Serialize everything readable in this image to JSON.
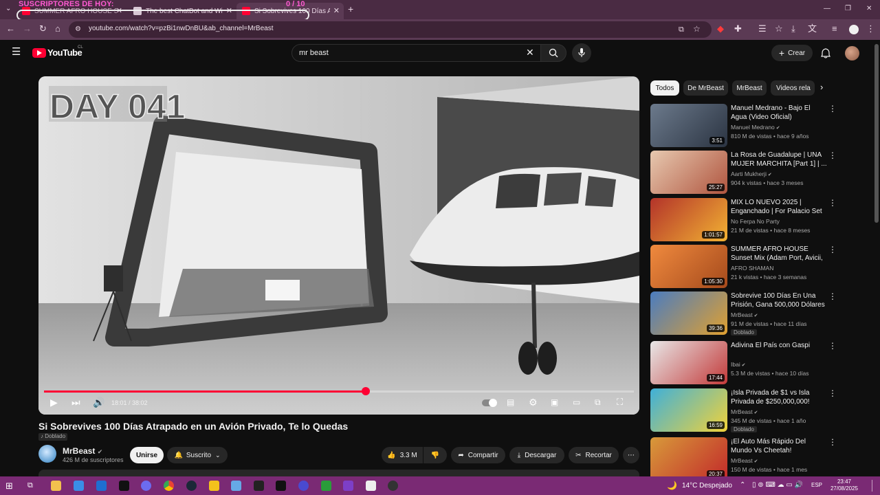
{
  "overlay": {
    "title": "SUSCRIPTORES DE HOY:",
    "count": "0 / 10"
  },
  "tabs": [
    {
      "title": "SUMMER AFRO HOUSE Sunset"
    },
    {
      "title": "The best ChatBot and Widgets"
    },
    {
      "title": "Si Sobrevives 100 Días Atrapado"
    }
  ],
  "browser": {
    "url": "youtube.com/watch?v=pzBi1nwDnBU&ab_channel=MrBeast"
  },
  "header": {
    "logo": "YouTube",
    "region": "CL",
    "search_value": "mr beast",
    "create_label": "Crear"
  },
  "player": {
    "overlay_text": "DAY 041",
    "time": "18:01 / 38:02",
    "progress": 0.545
  },
  "video": {
    "title": "Si Sobrevives 100 Días Atrapado en un Avión Privado, Te lo Quedas",
    "dub_badge": "Doblado",
    "channel": "MrBeast",
    "subscribers": "426 M de suscriptores",
    "join_label": "Unirse",
    "subscribed_label": "Suscrito",
    "likes": "3.3 M",
    "share_label": "Compartir",
    "download_label": "Descargar",
    "clip_label": "Recortar"
  },
  "chips": [
    "Todos",
    "De MrBeast",
    "MrBeast",
    "Videos rela"
  ],
  "recommendations": [
    {
      "title": "Manuel Medrano - Bajo El Agua (Video Oficial)",
      "channel": "Manuel Medrano",
      "verified": true,
      "meta": "810 M de vistas • hace 9 años",
      "duration": "3:51",
      "dubbed": "",
      "colors": [
        "#6c7a8c",
        "#2b3442"
      ]
    },
    {
      "title": "La Rosa de Guadalupe | UNA MUJER MARCHITA [Part 1] | ...",
      "channel": "Aarti Mukherji",
      "verified": true,
      "meta": "904 k vistas • hace 3 meses",
      "duration": "25:27",
      "dubbed": "",
      "colors": [
        "#e7c9b0",
        "#b0553f"
      ]
    },
    {
      "title": "MIX LO NUEVO 2025 | Enganchado | For Palacio Set ...",
      "channel": "No Ferpa No Party",
      "verified": false,
      "meta": "21 M de vistas • hace 8 meses",
      "duration": "1:01:57",
      "dubbed": "",
      "colors": [
        "#b3332a",
        "#f2b233"
      ]
    },
    {
      "title": "SUMMER AFRO HOUSE Sunset Mix (Adam Port, Avicii, The ...",
      "channel": "AFRO SHAMAN",
      "verified": false,
      "meta": "21 k vistas • hace 3 semanas",
      "duration": "1:05:30",
      "dubbed": "",
      "colors": [
        "#f08a3e",
        "#a54a1c"
      ]
    },
    {
      "title": "Sobrevive 100 Días En Una Prisión, Gana 500,000 Dólares",
      "channel": "MrBeast",
      "verified": true,
      "meta": "91 M de vistas • hace 11 días",
      "duration": "39:36",
      "dubbed": "Doblado",
      "colors": [
        "#4a7cc0",
        "#e0a030"
      ]
    },
    {
      "title": "Adivina El País con Gaspi",
      "channel": "Ibai",
      "verified": true,
      "meta": "5.3 M de vistas • hace 10 días",
      "duration": "17:44",
      "dubbed": "",
      "colors": [
        "#e8e8e8",
        "#c33a3a"
      ]
    },
    {
      "title": "¡Isla Privada de $1 vs Isla Privada de $250,000,000!",
      "channel": "MrBeast",
      "verified": true,
      "meta": "345 M de vistas • hace 1 año",
      "duration": "16:59",
      "dubbed": "Doblado",
      "colors": [
        "#3fb0d9",
        "#f0d23a"
      ]
    },
    {
      "title": "¡El Auto Más Rápido Del Mundo Vs Cheetah!",
      "channel": "MrBeast",
      "verified": true,
      "meta": "150 M de vistas • hace 1 mes",
      "duration": "20:37",
      "dubbed": "",
      "colors": [
        "#d89a3a",
        "#c22a2a"
      ]
    }
  ],
  "taskbar": {
    "weather": "14°C  Despejado",
    "lang": "ESP",
    "time": "23:47",
    "date": "27/08/2025"
  }
}
